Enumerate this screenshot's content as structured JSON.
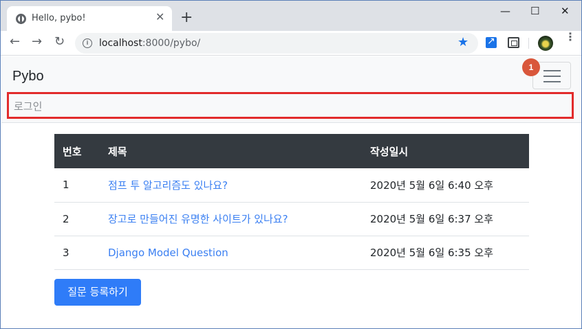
{
  "browser": {
    "tab_title": "Hello, pybo!",
    "tab_close": "✕",
    "new_tab": "+",
    "window_controls": {
      "minimize": "—",
      "maximize": "☐",
      "close": "✕"
    },
    "nav": {
      "back": "←",
      "forward": "→",
      "reload": "↻"
    },
    "url_host": "localhost",
    "url_path": ":8000/pybo/",
    "info_icon": "i",
    "bookmark_star": "★",
    "menu": "⋮"
  },
  "navbar": {
    "brand": "Pybo",
    "badge_count": "1",
    "login_link": "로그인"
  },
  "table": {
    "headers": [
      "번호",
      "제목",
      "작성일시"
    ],
    "rows": [
      {
        "num": "1",
        "title": "점프 투 알고리즘도 있나요?",
        "date": "2020년 5월 6일 6:40 오후"
      },
      {
        "num": "2",
        "title": "장고로 만들어진 유명한 사이트가 있나요?",
        "date": "2020년 5월 6일 6:37 오후"
      },
      {
        "num": "3",
        "title": "Django Model Question",
        "date": "2020년 5월 6일 6:35 오후"
      }
    ]
  },
  "actions": {
    "create_question": "질문 등록하기"
  },
  "colors": {
    "primary": "#2f7cf8",
    "header_dark": "#343a40",
    "highlight_red": "#e22b2b",
    "badge": "#d9573b"
  }
}
